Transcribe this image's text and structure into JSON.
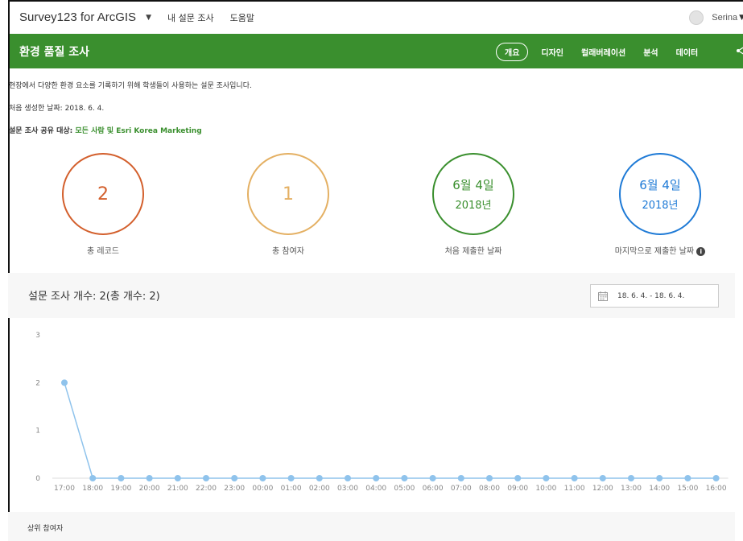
{
  "topbar": {
    "app_title": "Survey123 for ArcGIS",
    "nav": [
      "내 설문 조사",
      "도움말"
    ],
    "user_name": "Serina"
  },
  "survey": {
    "title": "환경 품질 조사",
    "tabs": [
      "개요",
      "디자인",
      "컬래버레이션",
      "분석",
      "데이터"
    ],
    "active_tab": "개요"
  },
  "info": {
    "description": "현장에서 다양한 환경 요소를 기록하기 위해 학생들이 사용하는 설문 조사입니다.",
    "created_label": "처음 생성한 날짜:",
    "created_value": "2018. 6. 4.",
    "shared_label": "설문 조사 공유 대상:",
    "shared_value": "모든 사람 및 Esri Korea Marketing"
  },
  "stats": {
    "total_records": {
      "value": "2",
      "label": "총 레코드",
      "color": "#d35f2c"
    },
    "total_participants": {
      "value": "1",
      "label": "총 참여자",
      "color": "#e4b063"
    },
    "first_submitted": {
      "date": "6월 4일",
      "year": "2018년",
      "label": "처음 제출한 날짜",
      "color": "#3a8f2e"
    },
    "last_submitted": {
      "date": "6월 4일",
      "year": "2018년",
      "label": "마지막으로 제출한 날짜",
      "color": "#1e7ad6"
    }
  },
  "counts": {
    "title": "설문 조사 개수: 2(총 개수: 2)",
    "date_range": "18. 6. 4. - 18. 6. 4."
  },
  "chart_data": {
    "type": "line",
    "categories": [
      "17:00",
      "18:00",
      "19:00",
      "20:00",
      "21:00",
      "22:00",
      "23:00",
      "00:00",
      "01:00",
      "02:00",
      "03:00",
      "04:00",
      "05:00",
      "06:00",
      "07:00",
      "08:00",
      "09:00",
      "10:00",
      "11:00",
      "12:00",
      "13:00",
      "14:00",
      "15:00",
      "16:00"
    ],
    "values": [
      2,
      0,
      0,
      0,
      0,
      0,
      0,
      0,
      0,
      0,
      0,
      0,
      0,
      0,
      0,
      0,
      0,
      0,
      0,
      0,
      0,
      0,
      0,
      0
    ],
    "yticks": [
      0,
      1,
      2,
      3
    ],
    "ylim": [
      0,
      3
    ],
    "color": "#8fc3ec",
    "grid": false
  },
  "top_participants": {
    "title": "상위 참여자"
  }
}
